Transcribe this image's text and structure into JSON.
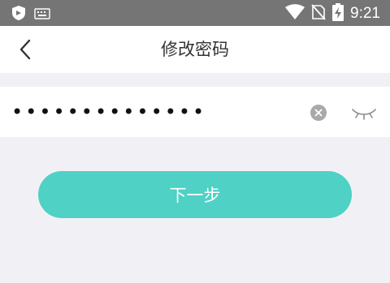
{
  "status_bar": {
    "time": "9:21",
    "icons": [
      "shield-icon",
      "keyboard-icon",
      "wifi-icon",
      "no-sim-icon",
      "battery-charging-icon"
    ]
  },
  "header": {
    "back_icon": "chevron-left-icon",
    "title": "修改密码"
  },
  "password_field": {
    "value": "••••••••••••••",
    "clear_icon": "clear-icon",
    "visibility_icon": "eye-closed-icon"
  },
  "next_button": {
    "label": "下一步",
    "color": "#4fd1c5"
  },
  "colors": {
    "status_bar": "#757575",
    "background": "#f1f1f5",
    "surface": "#ffffff",
    "title_text": "#333333"
  }
}
